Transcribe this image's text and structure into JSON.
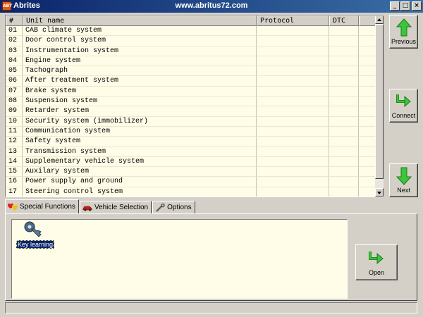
{
  "window": {
    "title": "Abrites",
    "url": "www.abritus72.com",
    "icon_text": "ABT"
  },
  "title_buttons": {
    "minimize": "_",
    "maximize": "□",
    "close": "×"
  },
  "table": {
    "columns": [
      "#",
      "Unit name",
      "Protocol",
      "DTC",
      ""
    ],
    "rows": [
      {
        "num": "01",
        "name": "CAB climate system",
        "protocol": "",
        "dtc": ""
      },
      {
        "num": "02",
        "name": "Door control system",
        "protocol": "",
        "dtc": ""
      },
      {
        "num": "03",
        "name": "Instrumentation system",
        "protocol": "",
        "dtc": ""
      },
      {
        "num": "04",
        "name": "Engine system",
        "protocol": "",
        "dtc": ""
      },
      {
        "num": "05",
        "name": "Tachograph",
        "protocol": "",
        "dtc": ""
      },
      {
        "num": "06",
        "name": "After treatment system",
        "protocol": "",
        "dtc": ""
      },
      {
        "num": "07",
        "name": "Brake system",
        "protocol": "",
        "dtc": ""
      },
      {
        "num": "08",
        "name": "Suspension system",
        "protocol": "",
        "dtc": ""
      },
      {
        "num": "09",
        "name": "Retarder system",
        "protocol": "",
        "dtc": ""
      },
      {
        "num": "10",
        "name": "Security system (immobilizer)",
        "protocol": "",
        "dtc": ""
      },
      {
        "num": "11",
        "name": "Communication system",
        "protocol": "",
        "dtc": ""
      },
      {
        "num": "12",
        "name": "Safety system",
        "protocol": "",
        "dtc": ""
      },
      {
        "num": "13",
        "name": "Transmission system",
        "protocol": "",
        "dtc": ""
      },
      {
        "num": "14",
        "name": "Supplementary vehicle system",
        "protocol": "",
        "dtc": ""
      },
      {
        "num": "15",
        "name": "Auxilary system",
        "protocol": "",
        "dtc": ""
      },
      {
        "num": "16",
        "name": "Power supply and ground",
        "protocol": "",
        "dtc": ""
      },
      {
        "num": "17",
        "name": "Steering control system",
        "protocol": "",
        "dtc": ""
      }
    ]
  },
  "nav": {
    "previous": "Previous",
    "connect": "Connect",
    "next": "Next"
  },
  "tabs": [
    {
      "label": "Special Functions",
      "icon": "hearts-icon",
      "active": true
    },
    {
      "label": "Vehicle Selection",
      "icon": "car-icon",
      "active": false
    },
    {
      "label": "Options",
      "icon": "wrench-icon",
      "active": false
    }
  ],
  "functions": [
    {
      "label": "Key learning",
      "icon": "key-icon",
      "selected": true
    }
  ],
  "open_button": "Open",
  "status": "",
  "colors": {
    "list_background": "#fffce7",
    "window_background": "#d4d0c8",
    "arrow_green": "#3cc43c",
    "selection": "#0a246a"
  }
}
